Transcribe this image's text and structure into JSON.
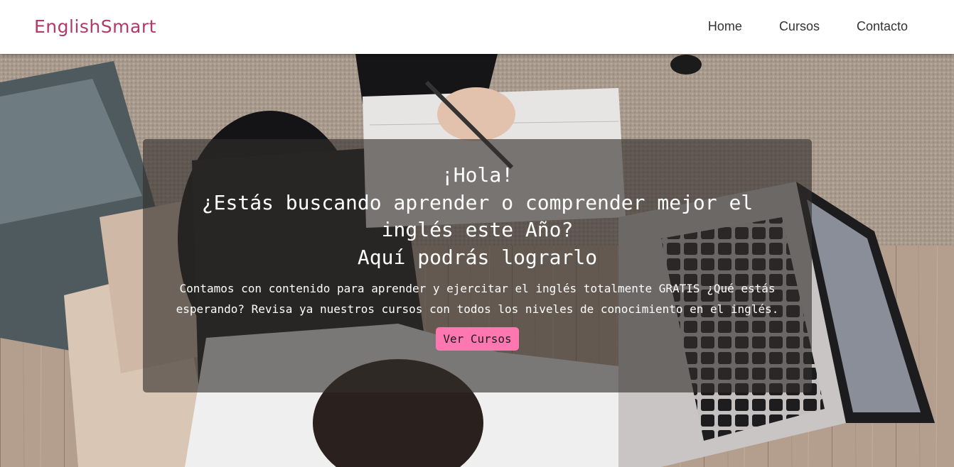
{
  "navbar": {
    "brand": "EnglishSmart",
    "links": [
      "Home",
      "Cursos",
      "Contacto"
    ]
  },
  "hero": {
    "greeting": "¡Hola!",
    "question": "¿Estás buscando aprender o comprender mejor el inglés este Año?",
    "tagline": "Aquí podrás lograrlo",
    "description": "Contamos con contenido para aprender y ejercitar el inglés totalmente GRATIS ¿Qué estás esperando? Revisa ya nuestros cursos con todos los niveles de conocimiento en el inglés.",
    "cta_label": "Ver Cursos"
  },
  "colors": {
    "brand": "#b03a6a",
    "cta": "#ff77b0",
    "card_overlay": "rgba(50,46,44,0.62)"
  }
}
